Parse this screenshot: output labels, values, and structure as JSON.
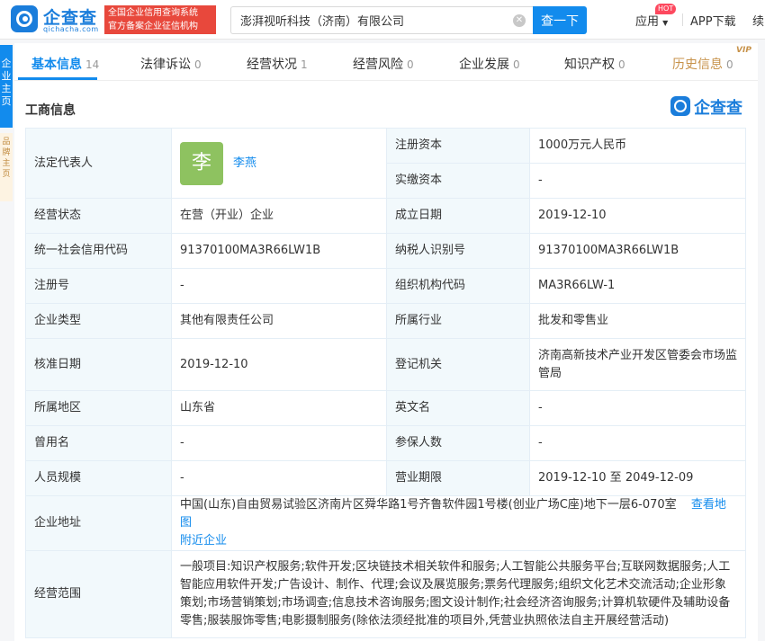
{
  "header": {
    "logo_text": "企查查",
    "logo_domain": "qichacha.com",
    "slogan_line1": "全国企业信用查询系统",
    "slogan_line2": "官方备案企业征信机构",
    "search_value": "澎湃视听科技（济南）有限公司",
    "search_button": "查一下",
    "nav_apps": "应用",
    "hot_badge": "HOT",
    "nav_app_download": "APP下载",
    "nav_more": "续"
  },
  "side": {
    "tab_text": "企业主页",
    "promo_text": "品牌主页"
  },
  "tabs": [
    {
      "label": "基本信息",
      "count": "14"
    },
    {
      "label": "法律诉讼",
      "count": "0"
    },
    {
      "label": "经营状况",
      "count": "1"
    },
    {
      "label": "经营风险",
      "count": "0"
    },
    {
      "label": "企业发展",
      "count": "0"
    },
    {
      "label": "知识产权",
      "count": "0"
    },
    {
      "label": "历史信息",
      "count": "0"
    }
  ],
  "vip_badge": "VIP",
  "section": {
    "title": "工商信息",
    "brand": "企查查"
  },
  "info": {
    "legal_rep_label": "法定代表人",
    "legal_rep_avatar": "李",
    "legal_rep_name": "李燕",
    "reg_capital_label": "注册资本",
    "reg_capital": "1000万元人民币",
    "paid_capital_label": "实缴资本",
    "paid_capital": "-",
    "status_label": "经营状态",
    "status": "在营（开业）企业",
    "founded_label": "成立日期",
    "founded": "2019-12-10",
    "credit_code_label": "统一社会信用代码",
    "credit_code": "91370100MA3R66LW1B",
    "taxpayer_id_label": "纳税人识别号",
    "taxpayer_id": "91370100MA3R66LW1B",
    "reg_no_label": "注册号",
    "reg_no": "-",
    "org_code_label": "组织机构代码",
    "org_code": "MA3R66LW-1",
    "company_type_label": "企业类型",
    "company_type": "其他有限责任公司",
    "industry_label": "所属行业",
    "industry": "批发和零售业",
    "approval_date_label": "核准日期",
    "approval_date": "2019-12-10",
    "authority_label": "登记机关",
    "authority": "济南高新技术产业开发区管委会市场监管局",
    "region_label": "所属地区",
    "region": "山东省",
    "english_name_label": "英文名",
    "english_name": "-",
    "former_name_label": "曾用名",
    "former_name": "-",
    "insured_label": "参保人数",
    "insured": "-",
    "staff_size_label": "人员规模",
    "staff_size": "-",
    "term_label": "营业期限",
    "term": "2019-12-10 至 2049-12-09",
    "address_label": "企业地址",
    "address": "中国(山东)自由贸易试验区济南片区舜华路1号齐鲁软件园1号楼(创业广场C座)地下一层6-070室",
    "map_link": "查看地图",
    "nearby_link": "附近企业",
    "scope_label": "经营范围",
    "scope": "一般项目:知识产权服务;软件开发;区块链技术相关软件和服务;人工智能公共服务平台;互联网数据服务;人工智能应用软件开发;广告设计、制作、代理;会议及展览服务;票务代理服务;组织文化艺术交流活动;企业形象策划;市场营销策划;市场调查;信息技术咨询服务;图文设计制作;社会经济咨询服务;计算机软硬件及辅助设备零售;服装服饰零售;电影摄制服务(除依法须经批准的项目外,凭营业执照依法自主开展经营活动)"
  }
}
